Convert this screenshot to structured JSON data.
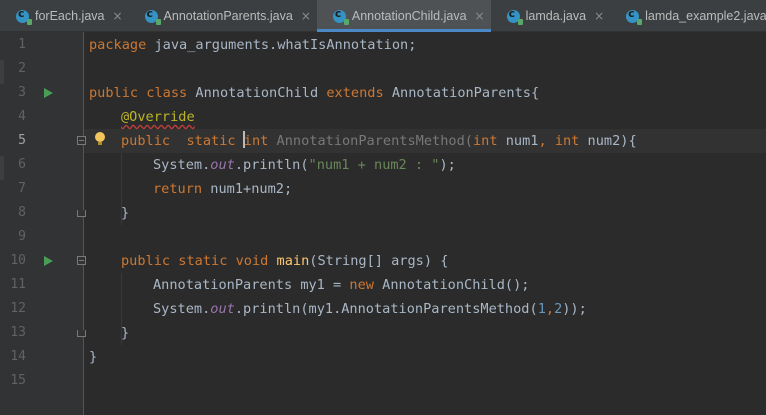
{
  "tabs": [
    {
      "label": "forEach.java",
      "active": false
    },
    {
      "label": "AnnotationParents.java",
      "active": false
    },
    {
      "label": "AnnotationChild.java",
      "active": true
    },
    {
      "label": "lamda.java",
      "active": false
    },
    {
      "label": "lamda_example2.java",
      "active": false
    }
  ],
  "tab_close_glyph": "×",
  "line_numbers": [
    "1",
    "2",
    "3",
    "4",
    "5",
    "6",
    "7",
    "8",
    "9",
    "10",
    "11",
    "12",
    "13",
    "14",
    "15"
  ],
  "current_line": "5",
  "code": {
    "l1": {
      "a": "package",
      "b": " java_arguments.whatIsAnnotation;"
    },
    "l3": {
      "a": "public",
      "b": " ",
      "c": "class",
      "d": " AnnotationChild ",
      "e": "extends",
      "f": " AnnotationParents{"
    },
    "l4": {
      "a": "@Override"
    },
    "l5": {
      "a": "public",
      "b": "  ",
      "c": "static",
      "d": " ",
      "e": "int",
      "f": " AnnotationParentsMethod(",
      "g": "int",
      "h": " num1",
      "i": ",",
      "j": " ",
      "k": "int",
      "l": " num2){"
    },
    "l6": {
      "a": "System.",
      "b": "out",
      "c": ".println(",
      "d": "\"num1 + num2 : \"",
      "e": ");"
    },
    "l7": {
      "a": "return",
      "b": " num1+num2;"
    },
    "l8": {
      "a": "}"
    },
    "l10": {
      "a": "public",
      "b": " ",
      "c": "static",
      "d": " ",
      "e": "void",
      "f": " ",
      "g": "main",
      "h": "(String[] args) {"
    },
    "l11": {
      "a": "AnnotationParents my1 = ",
      "b": "new",
      "c": " AnnotationChild();"
    },
    "l12": {
      "a": "System.",
      "b": "out",
      "c": ".println(my1.AnnotationParentsMethod(",
      "d": "1",
      "e": ",",
      "f": "2",
      "g": "));"
    },
    "l13": {
      "a": "}"
    },
    "l14": {
      "a": "}"
    }
  },
  "colors": {
    "background": "#2b2b2b",
    "keyword": "#cc7832",
    "annotation": "#bbb529",
    "string": "#6a8759",
    "field": "#9876aa",
    "method_decl": "#ffc66d",
    "number": "#6897bb",
    "text": "#a9b7c6",
    "tab_underline": "#4a88c7"
  },
  "icons": {
    "file_icon": "java-class-icon",
    "run_marker": "run-gutter-icon",
    "fold_marker": "fold-icon",
    "intention": "lightbulb-icon"
  }
}
